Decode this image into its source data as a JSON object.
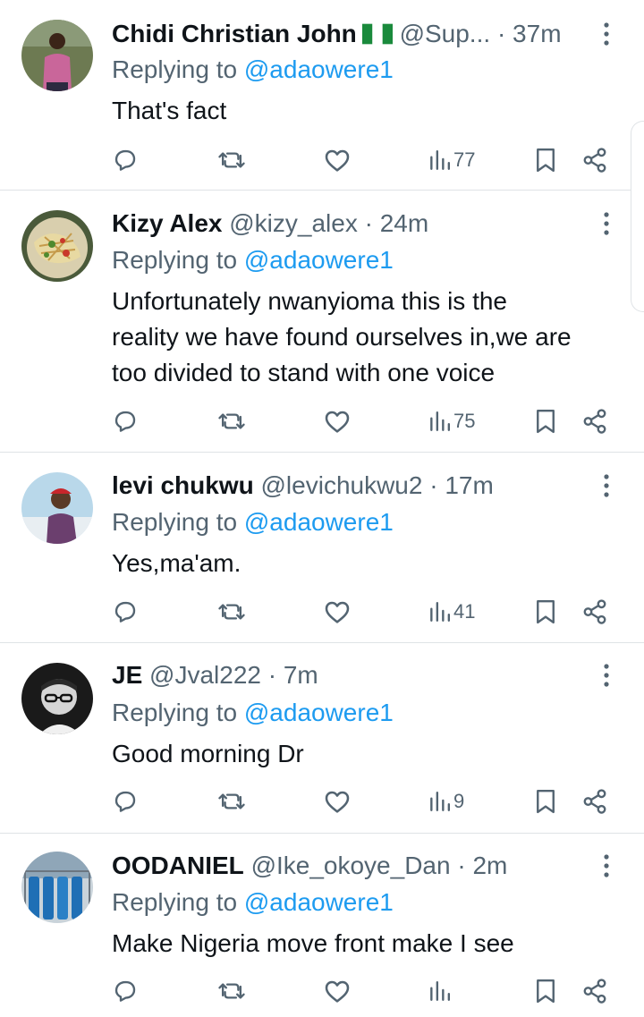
{
  "replies": [
    {
      "display_name": "Chidi Christian John",
      "has_flag": true,
      "handle": "@Sup...",
      "time": "37m",
      "replying_prefix": "Replying to",
      "replying_to": "@adaowere1",
      "text_lines": [
        "That's fact"
      ],
      "views": "77",
      "avatar_icon": "person-pink-shirt-avatar"
    },
    {
      "display_name": "Kizy Alex",
      "has_flag": false,
      "handle": "@kizy_alex",
      "time": "24m",
      "replying_prefix": "Replying to",
      "replying_to": "@adaowere1",
      "text_lines": [
        "Unfortunately nwanyioma this is the",
        "reality we have found ourselves in,we are",
        "too divided to stand with one voice"
      ],
      "views": "75",
      "avatar_icon": "food-plate-avatar"
    },
    {
      "display_name": "levi chukwu",
      "has_flag": false,
      "handle": "@levichukwu2",
      "time": "17m",
      "replying_prefix": "Replying to",
      "replying_to": "@adaowere1",
      "text_lines": [
        "Yes,ma'am."
      ],
      "views": "41",
      "avatar_icon": "man-red-cap-avatar"
    },
    {
      "display_name": "JE",
      "has_flag": false,
      "handle": "@Jval222",
      "time": "7m",
      "replying_prefix": "Replying to",
      "replying_to": "@adaowere1",
      "text_lines": [
        "Good morning Dr"
      ],
      "views": "9",
      "avatar_icon": "man-glasses-bw-avatar"
    },
    {
      "display_name": "OODANIEL",
      "has_flag": false,
      "handle": "@Ike_okoye_Dan",
      "time": "2m",
      "replying_prefix": "Replying to",
      "replying_to": "@adaowere1",
      "text_lines": [
        "Make Nigeria move front make I see"
      ],
      "views": "",
      "avatar_icon": "gas-cylinders-avatar"
    }
  ],
  "colors": {
    "text_primary": "#0f1419",
    "text_secondary": "#536471",
    "link": "#1d9bf0",
    "divider": "#dfe3e6"
  }
}
